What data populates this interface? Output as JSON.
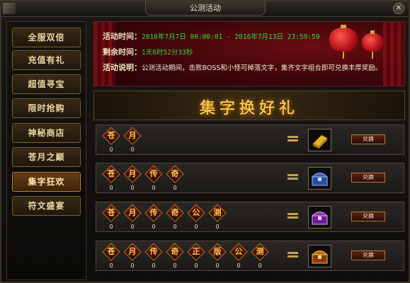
{
  "window": {
    "title": "公测活动"
  },
  "sidebar": {
    "items": [
      {
        "label": "全服双倍",
        "active": false
      },
      {
        "label": "充值有礼",
        "active": false
      },
      {
        "label": "超值寻宝",
        "active": false
      },
      {
        "label": "限时抢购",
        "active": false
      },
      {
        "label": "神秘商店",
        "active": false
      },
      {
        "label": "苍月之巅",
        "active": false
      },
      {
        "label": "集字狂欢",
        "active": true
      },
      {
        "label": "符文盛宴",
        "active": false
      }
    ]
  },
  "banner": {
    "time_label": "活动时间：",
    "time_value": "2016年7月7日 00:00:01 - 2016年7月13日 23:59:59",
    "remain_label": "剩余时间：",
    "remain_value": "1天6时52分33秒",
    "desc_label": "活动说明：",
    "desc_value": "公测活动期间，击败BOSS和小怪可掉落文字，集齐文字组合即可兑换丰厚奖励。"
  },
  "heading": "集字换好礼",
  "rewards": [
    {
      "chars": [
        "苍",
        "月"
      ],
      "counts": [
        "0",
        "0"
      ],
      "item": "gold-bar",
      "button": "兑换"
    },
    {
      "chars": [
        "苍",
        "月",
        "传",
        "奇"
      ],
      "counts": [
        "0",
        "0",
        "0",
        "0"
      ],
      "item": "blue-chest",
      "button": "兑换"
    },
    {
      "chars": [
        "苍",
        "月",
        "传",
        "奇",
        "公",
        "测"
      ],
      "counts": [
        "0",
        "0",
        "0",
        "0",
        "0",
        "0"
      ],
      "item": "purple-chest",
      "button": "兑换"
    },
    {
      "chars": [
        "苍",
        "月",
        "传",
        "奇",
        "正",
        "版",
        "公",
        "测"
      ],
      "counts": [
        "0",
        "0",
        "0",
        "0",
        "0",
        "0",
        "0",
        "0"
      ],
      "item": "gold-chest",
      "button": "兑换"
    }
  ],
  "colors": {
    "accent_gold": "#f6c24a",
    "time_green": "#2ddc4b",
    "banner_red": "#6a0d12"
  }
}
